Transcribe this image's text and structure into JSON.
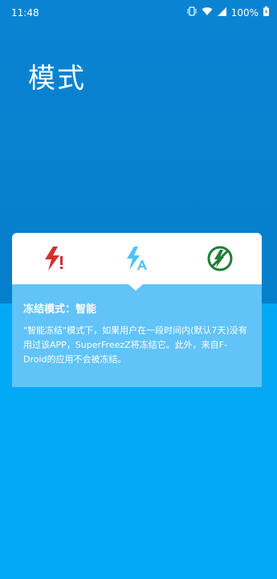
{
  "status_bar": {
    "time": "11:48",
    "battery": "100%"
  },
  "page": {
    "title": "模式"
  },
  "modes": {
    "items": [
      {
        "name": "freeze-always-icon",
        "color": "#d32f2f"
      },
      {
        "name": "freeze-auto-icon",
        "color": "#4fc3f7"
      },
      {
        "name": "freeze-never-icon",
        "color": "#1e7e34"
      }
    ],
    "selected_index": 1
  },
  "info": {
    "title": "冻结模式：智能",
    "description": "\"智能冻结\"模式下，如果用户在一段时间内(默认7天)没有用过该APP，SuperFreezZ将冻结它。此外，来自F-Droid的应用不会被冻结。"
  },
  "colors": {
    "top_panel": "#0a84d2",
    "background": "#03a9f4",
    "info_box": "#61c3f7"
  }
}
